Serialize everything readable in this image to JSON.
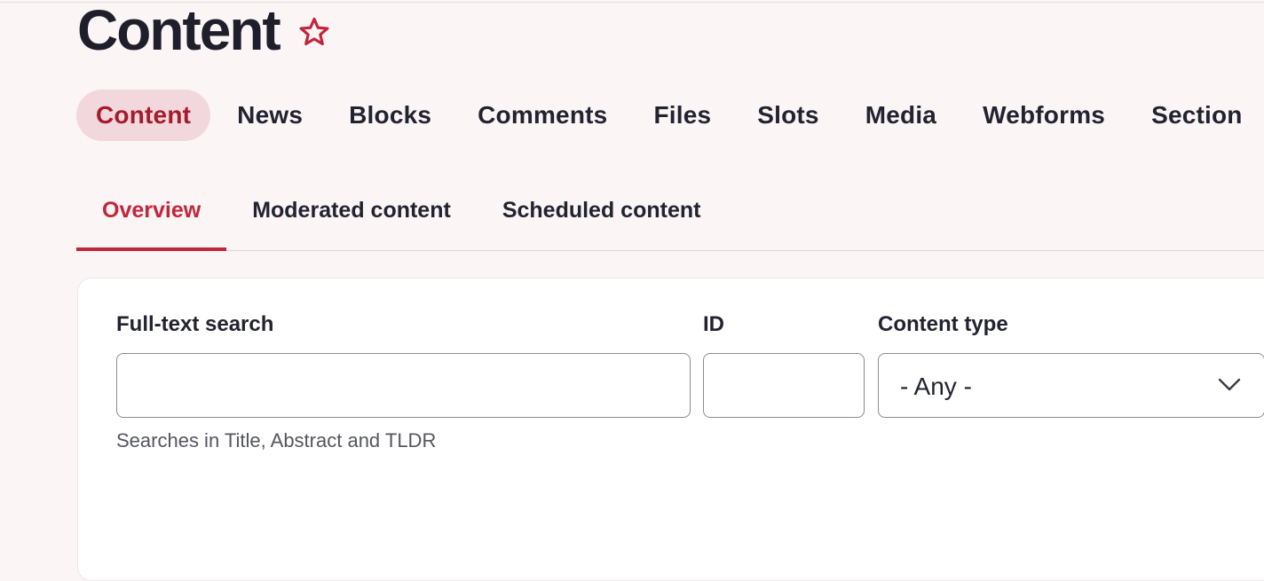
{
  "header": {
    "title": "Content",
    "favorite_icon": "star-outline-icon"
  },
  "primary_tabs": [
    {
      "label": "Content",
      "active": true
    },
    {
      "label": "News",
      "active": false
    },
    {
      "label": "Blocks",
      "active": false
    },
    {
      "label": "Comments",
      "active": false
    },
    {
      "label": "Files",
      "active": false
    },
    {
      "label": "Slots",
      "active": false
    },
    {
      "label": "Media",
      "active": false
    },
    {
      "label": "Webforms",
      "active": false
    },
    {
      "label": "Section",
      "active": false
    }
  ],
  "secondary_tabs": [
    {
      "label": "Overview",
      "active": true
    },
    {
      "label": "Moderated content",
      "active": false
    },
    {
      "label": "Scheduled content",
      "active": false
    }
  ],
  "filters": {
    "fulltext": {
      "label": "Full-text search",
      "value": "",
      "help": "Searches in Title, Abstract and TLDR"
    },
    "id": {
      "label": "ID",
      "value": ""
    },
    "content_type": {
      "label": "Content type",
      "selected": "- Any -"
    }
  },
  "colors": {
    "accent": "#c1263a",
    "active_pill_bg": "#f2d7dc",
    "active_pill_text": "#a51b2c",
    "page_bg": "#fcf5f6"
  }
}
